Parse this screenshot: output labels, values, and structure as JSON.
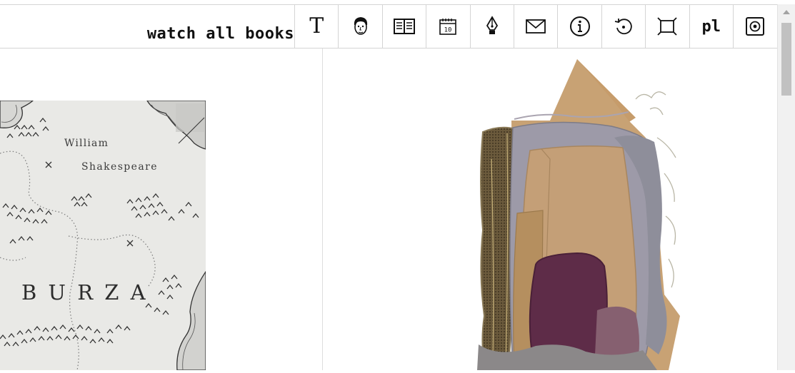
{
  "header": {
    "watch_all_label": "watch all books",
    "lang_label": "pl",
    "text_icon_glyph": "T",
    "icons": [
      "text-icon",
      "author-face-icon",
      "open-book-icon",
      "calendar-icon",
      "pen-nib-icon",
      "envelope-icon",
      "info-icon",
      "refresh-icon",
      "fullscreen-icon",
      "language-switch",
      "settings-icon"
    ],
    "calendar_day": "10"
  },
  "books": [
    {
      "author_first": "William",
      "author_last": "Shakespeare",
      "title": "B U R Z A"
    },
    {
      "title": ""
    }
  ],
  "colors": {
    "text": "#111111",
    "border": "#d4d4d4",
    "plum": "#5e2c48",
    "tan": "#c49f77"
  }
}
